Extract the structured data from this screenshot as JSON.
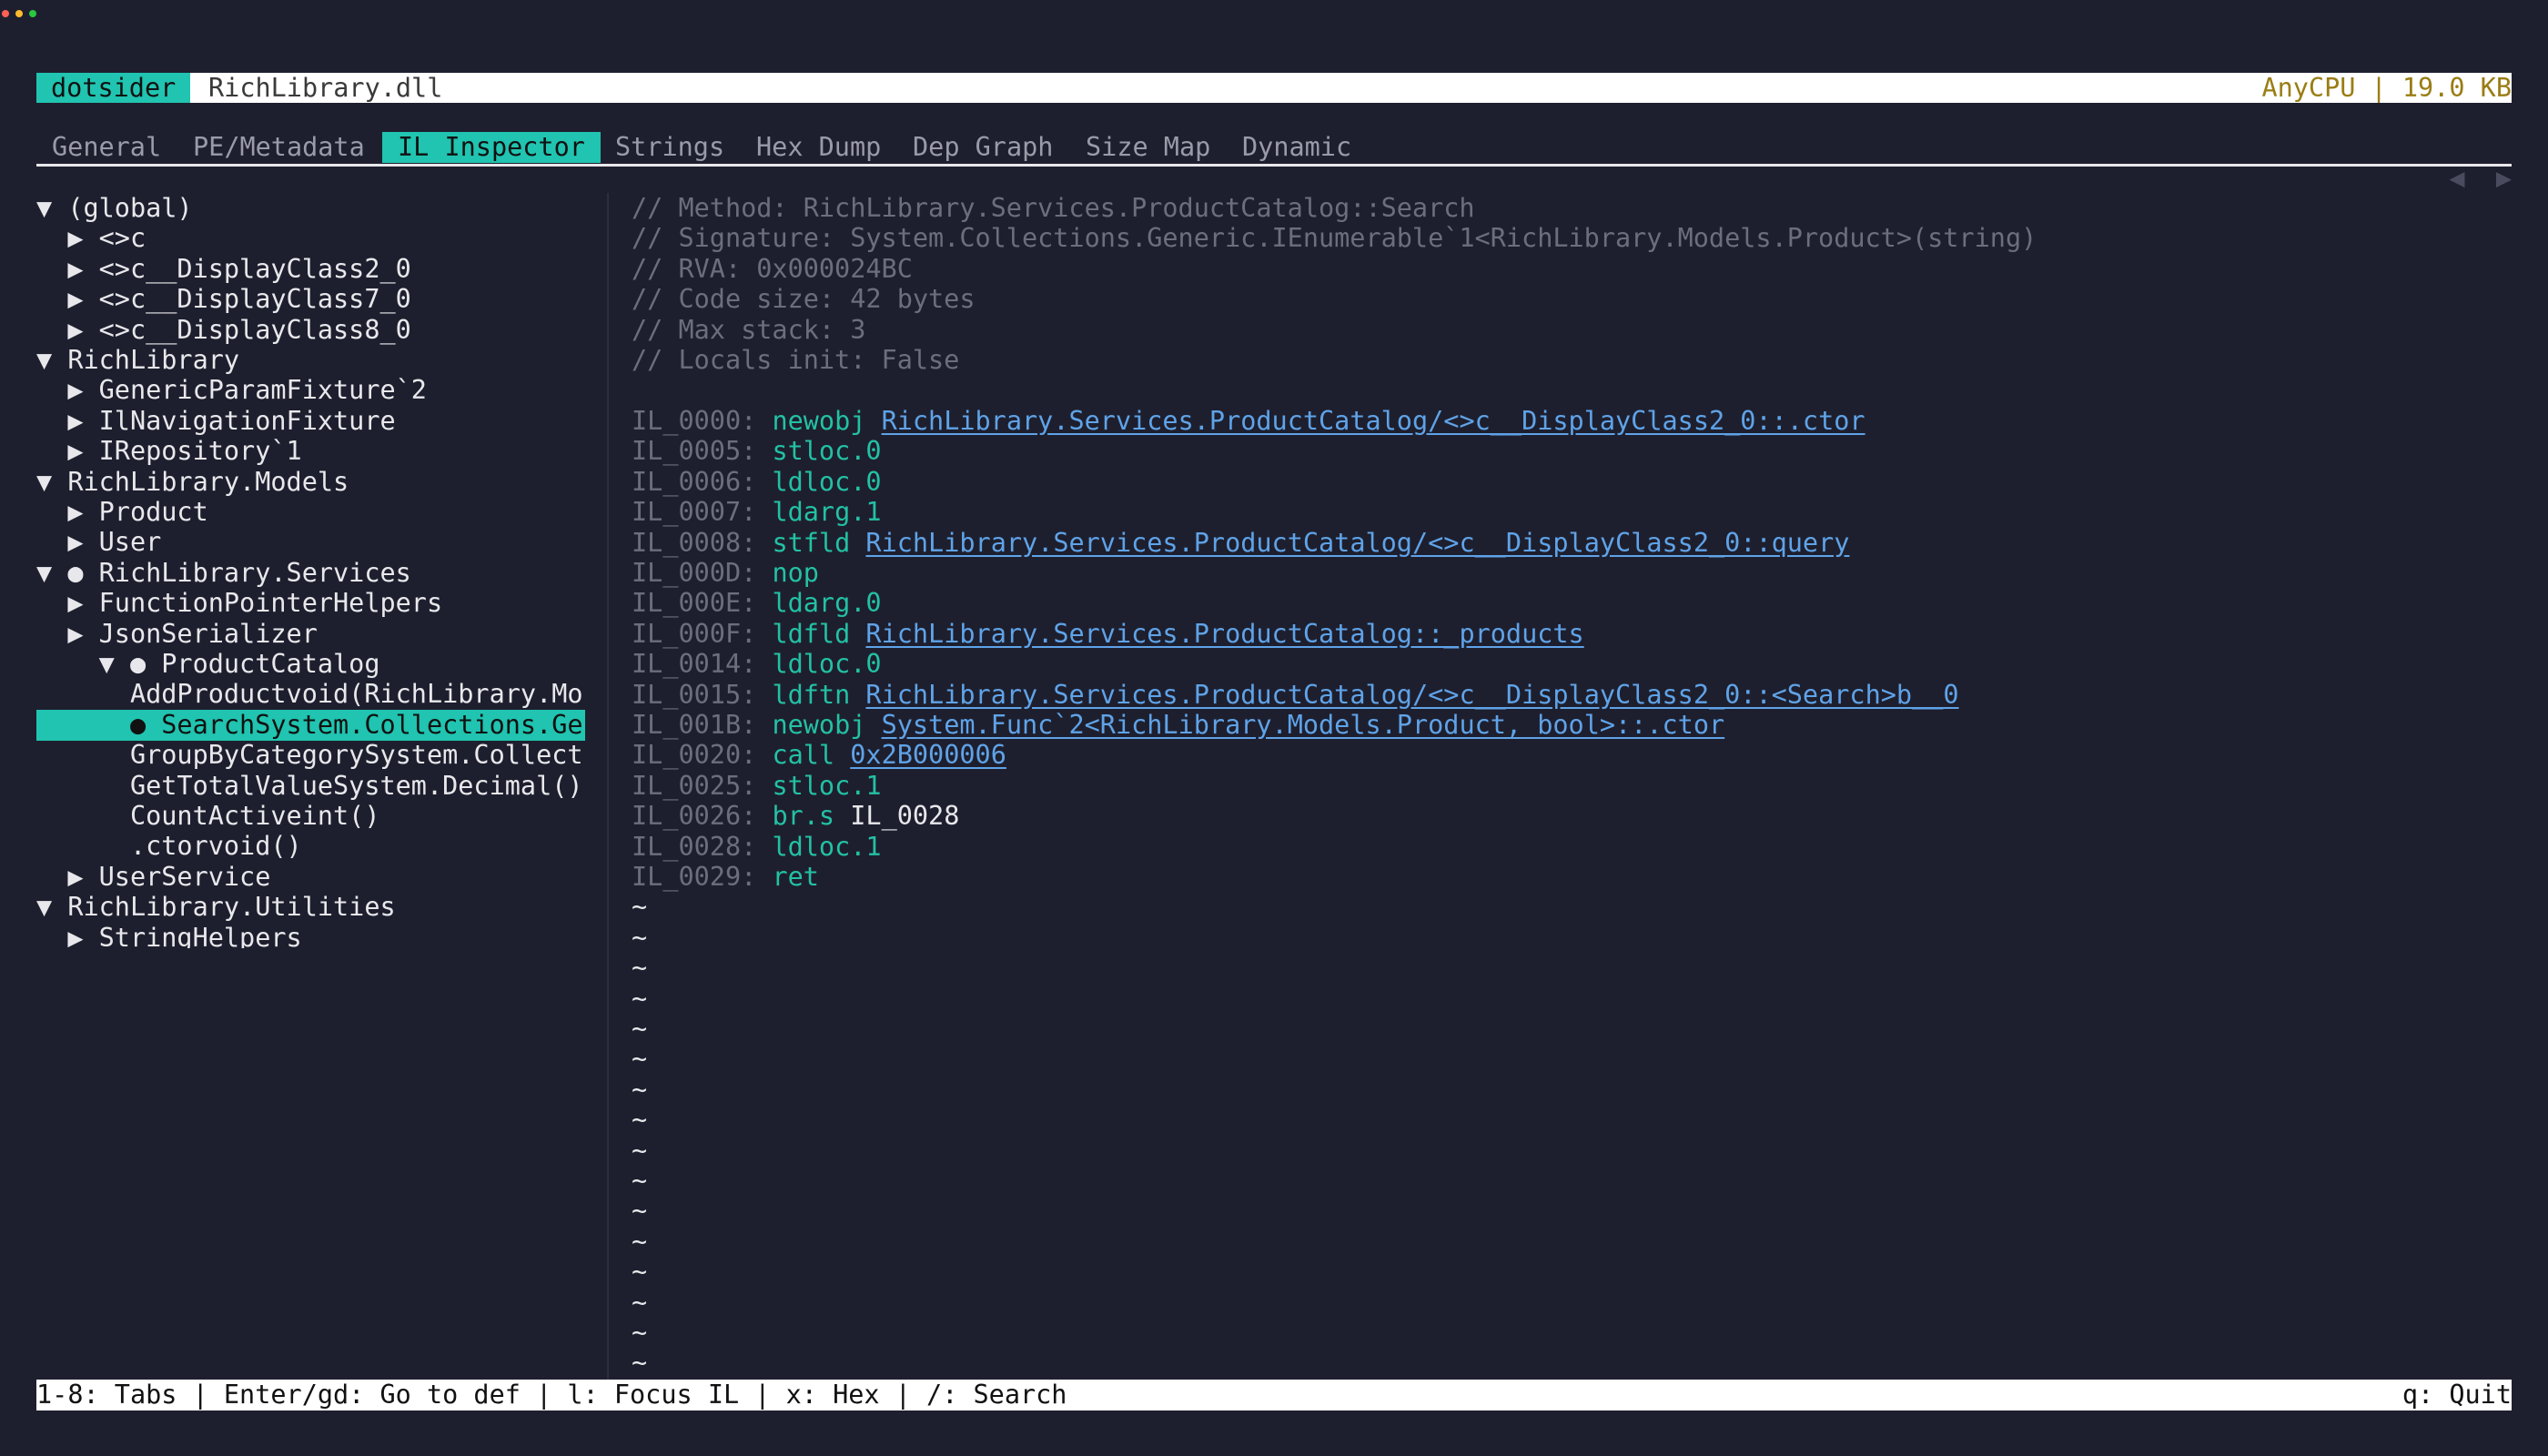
{
  "window": {
    "traffic_lights": [
      "close",
      "minimize",
      "zoom"
    ]
  },
  "titlebar": {
    "app_name": "dotsider",
    "file_name": "RichLibrary.dll",
    "file_info": "AnyCPU | 19.0 KB"
  },
  "tabs": [
    {
      "label": "General"
    },
    {
      "label": "PE/Metadata"
    },
    {
      "label": "IL Inspector",
      "active": true
    },
    {
      "label": "Strings"
    },
    {
      "label": "Hex Dump"
    },
    {
      "label": "Dep Graph"
    },
    {
      "label": "Size Map"
    },
    {
      "label": "Dynamic"
    }
  ],
  "tab_nav": {
    "prev": "◀",
    "next": "▶"
  },
  "tree": {
    "items": [
      {
        "text": "▼ (global)"
      },
      {
        "text": "  ▶ <>c"
      },
      {
        "text": "  ▶ <>c__DisplayClass2_0"
      },
      {
        "text": "  ▶ <>c__DisplayClass7_0"
      },
      {
        "text": "  ▶ <>c__DisplayClass8_0"
      },
      {
        "text": "▼ RichLibrary"
      },
      {
        "text": "  ▶ GenericParamFixture`2"
      },
      {
        "text": "  ▶ IlNavigationFixture"
      },
      {
        "text": "  ▶ IRepository`1"
      },
      {
        "text": "▼ RichLibrary.Models"
      },
      {
        "text": "  ▶ Product"
      },
      {
        "text": "  ▶ User"
      },
      {
        "text": "▼ ● RichLibrary.Services"
      },
      {
        "text": "  ▶ FunctionPointerHelpers"
      },
      {
        "text": "  ▶ JsonSerializer"
      },
      {
        "text": "    ▼ ● ProductCatalog"
      },
      {
        "text": "      AddProductvoid(RichLibrary.Mo"
      },
      {
        "text": "      ● SearchSystem.Collections.Ge",
        "selected": true
      },
      {
        "text": "      GroupByCategorySystem.Collect"
      },
      {
        "text": "      GetTotalValueSystem.Decimal()"
      },
      {
        "text": "      CountActiveint()"
      },
      {
        "text": "      .ctorvoid()"
      },
      {
        "text": "  ▶ UserService"
      },
      {
        "text": "▼ RichLibrary.Utilities"
      },
      {
        "text": "  ▶ StringHelpers"
      }
    ]
  },
  "il": {
    "header_comments": [
      "// Method: RichLibrary.Services.ProductCatalog::Search",
      "// Signature: System.Collections.Generic.IEnumerable`1<RichLibrary.Models.Product>(string)",
      "// RVA: 0x000024BC",
      "// Code size: 42 bytes",
      "// Max stack: 3",
      "// Locals init: False"
    ],
    "instructions": [
      {
        "addr": "IL_0000:",
        "op": "newobj",
        "operand": "RichLibrary.Services.ProductCatalog/<>c__DisplayClass2_0::.ctor",
        "operand_kind": "ref"
      },
      {
        "addr": "IL_0005:",
        "op": "stloc.0",
        "operand": "",
        "operand_kind": "none"
      },
      {
        "addr": "IL_0006:",
        "op": "ldloc.0",
        "operand": "",
        "operand_kind": "none"
      },
      {
        "addr": "IL_0007:",
        "op": "ldarg.1",
        "operand": "",
        "operand_kind": "none"
      },
      {
        "addr": "IL_0008:",
        "op": "stfld",
        "operand": "RichLibrary.Services.ProductCatalog/<>c__DisplayClass2_0::query",
        "operand_kind": "ref"
      },
      {
        "addr": "IL_000D:",
        "op": "nop",
        "operand": "",
        "operand_kind": "none"
      },
      {
        "addr": "IL_000E:",
        "op": "ldarg.0",
        "operand": "",
        "operand_kind": "none"
      },
      {
        "addr": "IL_000F:",
        "op": "ldfld",
        "operand": "RichLibrary.Services.ProductCatalog::_products",
        "operand_kind": "ref"
      },
      {
        "addr": "IL_0014:",
        "op": "ldloc.0",
        "operand": "",
        "operand_kind": "none"
      },
      {
        "addr": "IL_0015:",
        "op": "ldftn",
        "operand": "RichLibrary.Services.ProductCatalog/<>c__DisplayClass2_0::<Search>b__0",
        "operand_kind": "ref"
      },
      {
        "addr": "IL_001B:",
        "op": "newobj",
        "operand": "System.Func`2<RichLibrary.Models.Product, bool>::.ctor",
        "operand_kind": "ref"
      },
      {
        "addr": "IL_0020:",
        "op": "call",
        "operand": "0x2B000006",
        "operand_kind": "ref"
      },
      {
        "addr": "IL_0025:",
        "op": "stloc.1",
        "operand": "",
        "operand_kind": "none"
      },
      {
        "addr": "IL_0026:",
        "op": "br.s",
        "operand": "IL_0028",
        "operand_kind": "plain"
      },
      {
        "addr": "IL_0028:",
        "op": "ldloc.1",
        "operand": "",
        "operand_kind": "none"
      },
      {
        "addr": "IL_0029:",
        "op": "ret",
        "operand": "",
        "operand_kind": "none"
      }
    ],
    "filler": [
      "~",
      "~",
      "~",
      "~",
      "~",
      "~",
      "~",
      "~",
      "~",
      "~",
      "~",
      "~",
      "~",
      "~",
      "~",
      "~"
    ]
  },
  "statusbar": {
    "left": "1-8: Tabs | Enter/gd: Go to def | l: Focus IL | x: Hex | /: Search",
    "right": "q: Quit"
  },
  "colors": {
    "background": "#1e1f2e",
    "accent": "#20c4b0",
    "opcode": "#23c1a4",
    "reference": "#5fa3e8",
    "comment": "#6c6d7e",
    "file_info": "#9a7d14"
  }
}
